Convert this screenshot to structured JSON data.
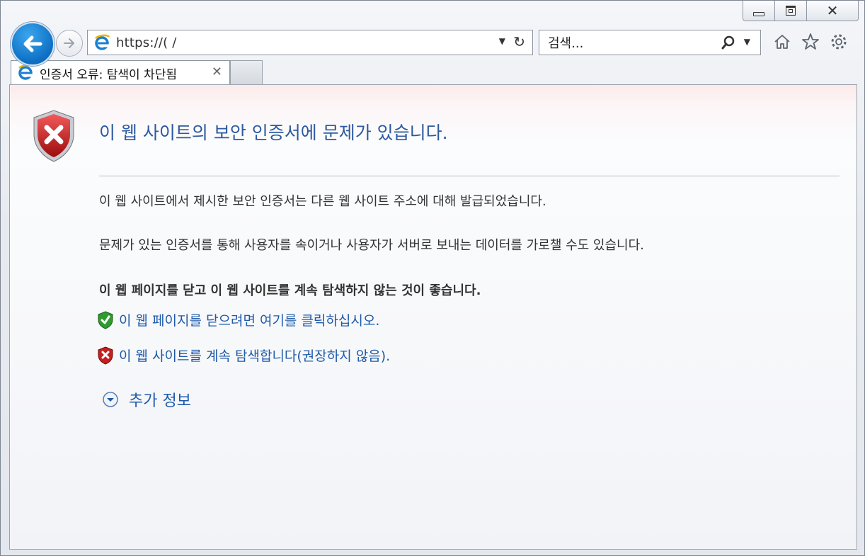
{
  "browser": {
    "address_url": "https://(                          /",
    "search_placeholder": "검색...",
    "tab_title": "인증서 오류: 탐색이 차단됨",
    "tab_close": "✕"
  },
  "page": {
    "headline": "이 웹 사이트의 보안 인증서에 문제가 있습니다.",
    "paragraph1": "이 웹 사이트에서 제시한 보안 인증서는 다른 웹 사이트 주소에 대해 발급되었습니다.",
    "paragraph2": "문제가 있는 인증서를 통해 사용자를 속이거나 사용자가 서버로 보내는 데이터를 가로챌 수도 있습니다.",
    "recommendation": "이 웹 페이지를 닫고 이 웹 사이트를 계속 탐색하지 않는 것이 좋습니다.",
    "link_close": "이 웹 페이지를 닫으려면 여기를 클릭하십시오.",
    "link_continue": "이 웹 사이트를 계속 탐색합니다(권장하지 않음).",
    "more_info": "추가 정보"
  },
  "icons": [
    "back-arrow-icon",
    "forward-arrow-icon",
    "ie-logo-icon",
    "dropdown-icon",
    "refresh-icon",
    "search-icon",
    "home-icon",
    "favorites-star-icon",
    "settings-gear-icon",
    "shield-error-icon",
    "shield-ok-icon",
    "expand-chevron-icon"
  ],
  "colors": {
    "accent": "#2c5aa0",
    "link": "#1e5aa8",
    "back_button": "#0d6fc4"
  }
}
